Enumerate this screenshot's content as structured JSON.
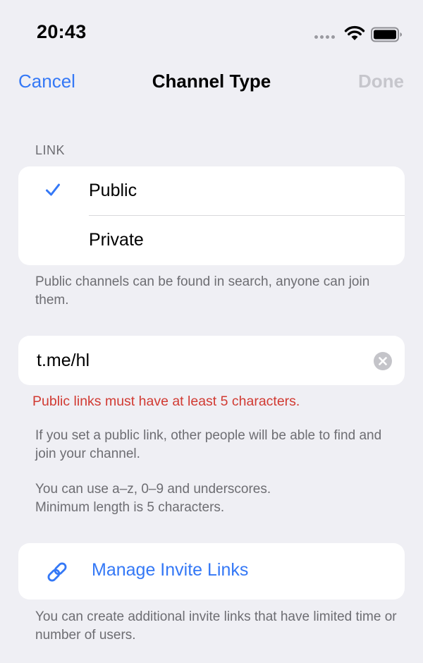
{
  "status_bar": {
    "time": "20:43",
    "signal_icon": "cellular-dots-icon",
    "wifi_icon": "wifi-icon",
    "battery_icon": "battery-icon"
  },
  "nav": {
    "cancel_label": "Cancel",
    "title": "Channel Type",
    "done_label": "Done"
  },
  "link_section": {
    "header": "LINK",
    "options": [
      {
        "label": "Public",
        "selected": true
      },
      {
        "label": "Private",
        "selected": false
      }
    ],
    "footer": "Public channels can be found in search, anyone can join them."
  },
  "public_link": {
    "value": "t.me/hl",
    "error": "Public links must have at least 5 characters.",
    "info_1": "If you set a public link, other people will be able to find and join your channel.",
    "info_2_line1": "You can use a–z, 0–9 and underscores.",
    "info_2_line2": "Minimum length is 5 characters."
  },
  "invite": {
    "label": "Manage Invite Links",
    "icon": "link-icon",
    "footer": "You can create additional invite links that have limited time or number of users."
  },
  "colors": {
    "accent": "#3478f6",
    "error": "#d13a32",
    "background": "#efeff4",
    "secondary_text": "#6d6d72",
    "disabled": "#c6c6cc"
  }
}
